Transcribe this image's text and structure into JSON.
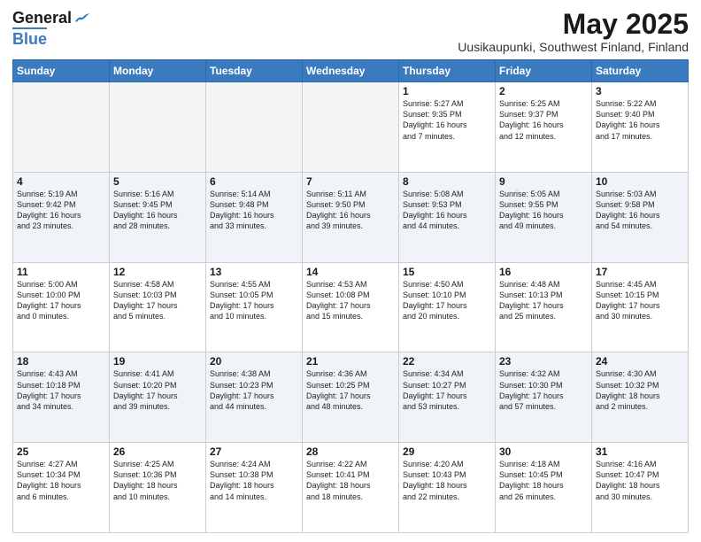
{
  "header": {
    "logo_general": "General",
    "logo_blue": "Blue",
    "title": "May 2025",
    "subtitle": "Uusikaupunki, Southwest Finland, Finland"
  },
  "calendar": {
    "days": [
      "Sunday",
      "Monday",
      "Tuesday",
      "Wednesday",
      "Thursday",
      "Friday",
      "Saturday"
    ],
    "rows": [
      [
        {
          "date": "",
          "text": ""
        },
        {
          "date": "",
          "text": ""
        },
        {
          "date": "",
          "text": ""
        },
        {
          "date": "",
          "text": ""
        },
        {
          "date": "1",
          "text": "Sunrise: 5:27 AM\nSunset: 9:35 PM\nDaylight: 16 hours\nand 7 minutes."
        },
        {
          "date": "2",
          "text": "Sunrise: 5:25 AM\nSunset: 9:37 PM\nDaylight: 16 hours\nand 12 minutes."
        },
        {
          "date": "3",
          "text": "Sunrise: 5:22 AM\nSunset: 9:40 PM\nDaylight: 16 hours\nand 17 minutes."
        }
      ],
      [
        {
          "date": "4",
          "text": "Sunrise: 5:19 AM\nSunset: 9:42 PM\nDaylight: 16 hours\nand 23 minutes."
        },
        {
          "date": "5",
          "text": "Sunrise: 5:16 AM\nSunset: 9:45 PM\nDaylight: 16 hours\nand 28 minutes."
        },
        {
          "date": "6",
          "text": "Sunrise: 5:14 AM\nSunset: 9:48 PM\nDaylight: 16 hours\nand 33 minutes."
        },
        {
          "date": "7",
          "text": "Sunrise: 5:11 AM\nSunset: 9:50 PM\nDaylight: 16 hours\nand 39 minutes."
        },
        {
          "date": "8",
          "text": "Sunrise: 5:08 AM\nSunset: 9:53 PM\nDaylight: 16 hours\nand 44 minutes."
        },
        {
          "date": "9",
          "text": "Sunrise: 5:05 AM\nSunset: 9:55 PM\nDaylight: 16 hours\nand 49 minutes."
        },
        {
          "date": "10",
          "text": "Sunrise: 5:03 AM\nSunset: 9:58 PM\nDaylight: 16 hours\nand 54 minutes."
        }
      ],
      [
        {
          "date": "11",
          "text": "Sunrise: 5:00 AM\nSunset: 10:00 PM\nDaylight: 17 hours\nand 0 minutes."
        },
        {
          "date": "12",
          "text": "Sunrise: 4:58 AM\nSunset: 10:03 PM\nDaylight: 17 hours\nand 5 minutes."
        },
        {
          "date": "13",
          "text": "Sunrise: 4:55 AM\nSunset: 10:05 PM\nDaylight: 17 hours\nand 10 minutes."
        },
        {
          "date": "14",
          "text": "Sunrise: 4:53 AM\nSunset: 10:08 PM\nDaylight: 17 hours\nand 15 minutes."
        },
        {
          "date": "15",
          "text": "Sunrise: 4:50 AM\nSunset: 10:10 PM\nDaylight: 17 hours\nand 20 minutes."
        },
        {
          "date": "16",
          "text": "Sunrise: 4:48 AM\nSunset: 10:13 PM\nDaylight: 17 hours\nand 25 minutes."
        },
        {
          "date": "17",
          "text": "Sunrise: 4:45 AM\nSunset: 10:15 PM\nDaylight: 17 hours\nand 30 minutes."
        }
      ],
      [
        {
          "date": "18",
          "text": "Sunrise: 4:43 AM\nSunset: 10:18 PM\nDaylight: 17 hours\nand 34 minutes."
        },
        {
          "date": "19",
          "text": "Sunrise: 4:41 AM\nSunset: 10:20 PM\nDaylight: 17 hours\nand 39 minutes."
        },
        {
          "date": "20",
          "text": "Sunrise: 4:38 AM\nSunset: 10:23 PM\nDaylight: 17 hours\nand 44 minutes."
        },
        {
          "date": "21",
          "text": "Sunrise: 4:36 AM\nSunset: 10:25 PM\nDaylight: 17 hours\nand 48 minutes."
        },
        {
          "date": "22",
          "text": "Sunrise: 4:34 AM\nSunset: 10:27 PM\nDaylight: 17 hours\nand 53 minutes."
        },
        {
          "date": "23",
          "text": "Sunrise: 4:32 AM\nSunset: 10:30 PM\nDaylight: 17 hours\nand 57 minutes."
        },
        {
          "date": "24",
          "text": "Sunrise: 4:30 AM\nSunset: 10:32 PM\nDaylight: 18 hours\nand 2 minutes."
        }
      ],
      [
        {
          "date": "25",
          "text": "Sunrise: 4:27 AM\nSunset: 10:34 PM\nDaylight: 18 hours\nand 6 minutes."
        },
        {
          "date": "26",
          "text": "Sunrise: 4:25 AM\nSunset: 10:36 PM\nDaylight: 18 hours\nand 10 minutes."
        },
        {
          "date": "27",
          "text": "Sunrise: 4:24 AM\nSunset: 10:38 PM\nDaylight: 18 hours\nand 14 minutes."
        },
        {
          "date": "28",
          "text": "Sunrise: 4:22 AM\nSunset: 10:41 PM\nDaylight: 18 hours\nand 18 minutes."
        },
        {
          "date": "29",
          "text": "Sunrise: 4:20 AM\nSunset: 10:43 PM\nDaylight: 18 hours\nand 22 minutes."
        },
        {
          "date": "30",
          "text": "Sunrise: 4:18 AM\nSunset: 10:45 PM\nDaylight: 18 hours\nand 26 minutes."
        },
        {
          "date": "31",
          "text": "Sunrise: 4:16 AM\nSunset: 10:47 PM\nDaylight: 18 hours\nand 30 minutes."
        }
      ]
    ],
    "alt_rows": [
      1,
      3
    ]
  }
}
